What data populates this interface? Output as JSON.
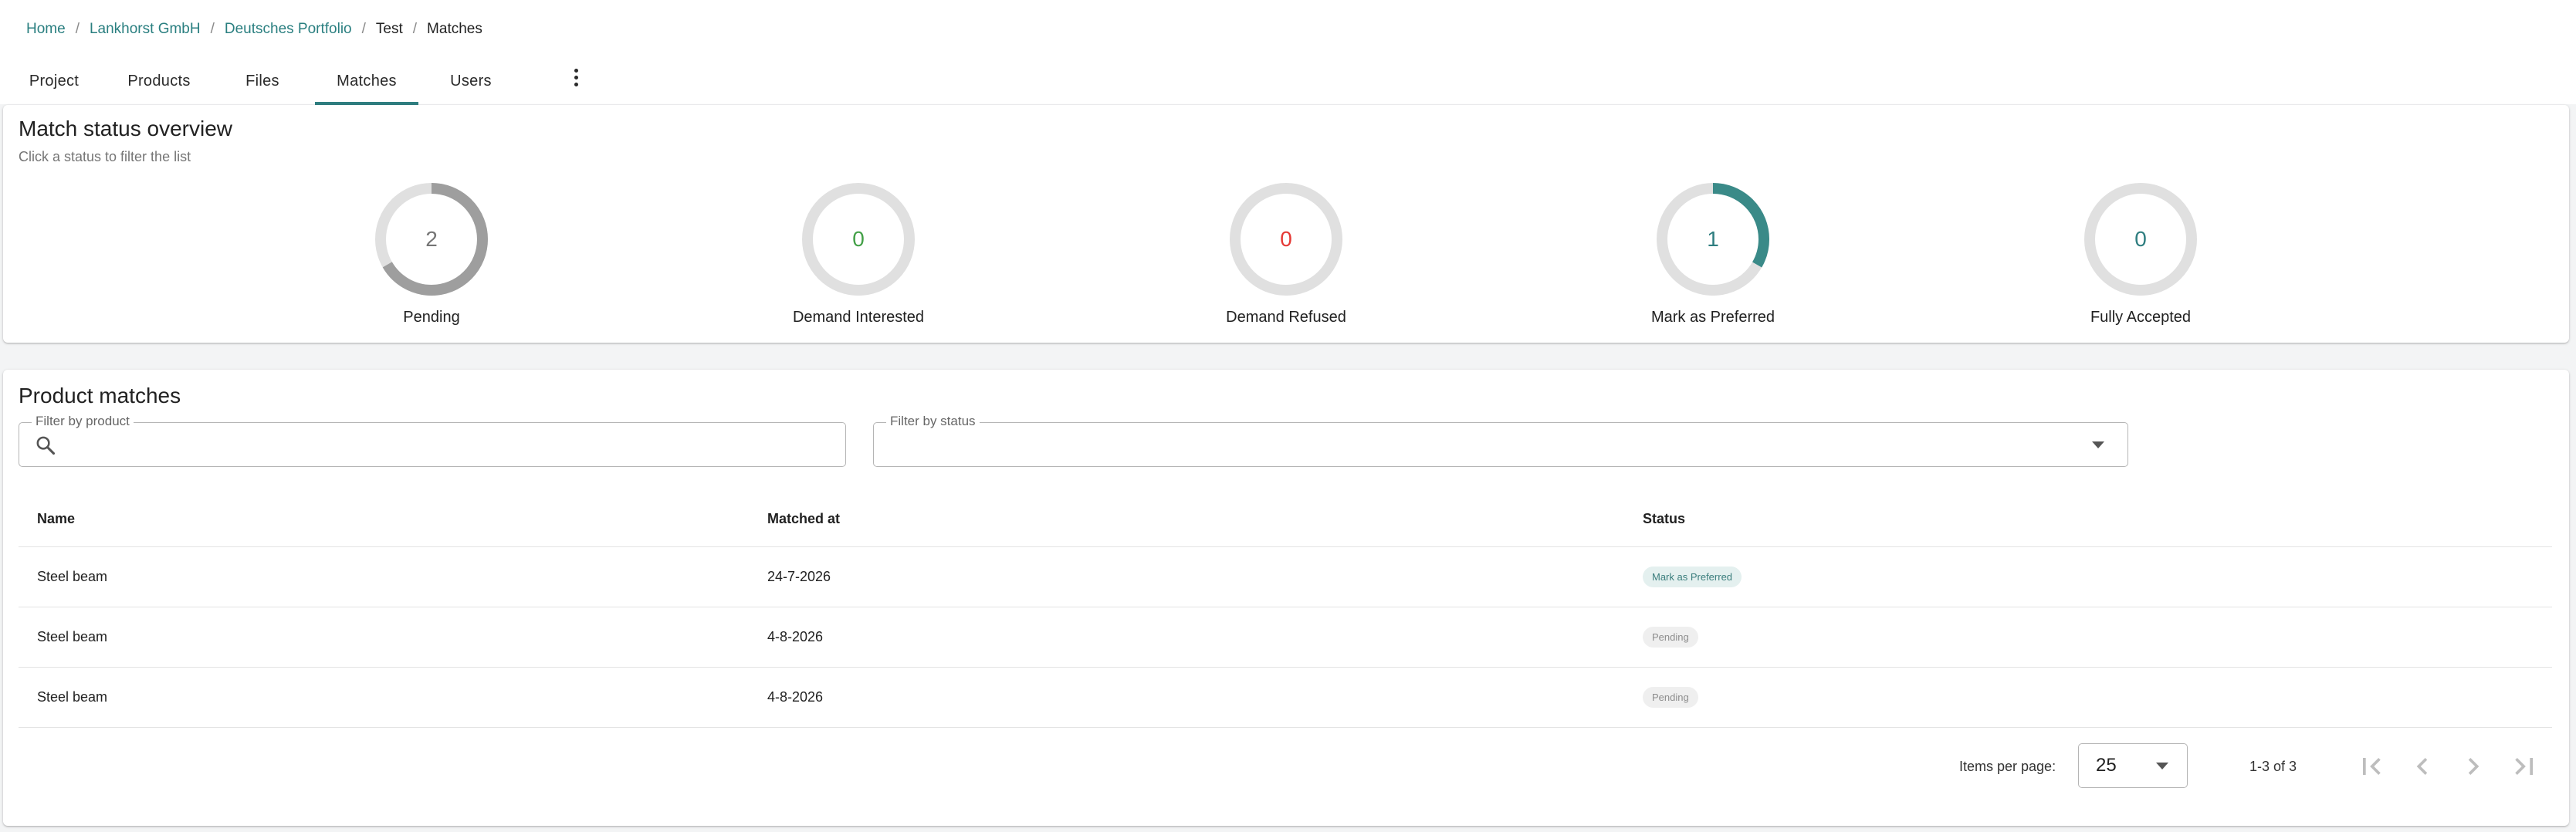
{
  "breadcrumb": {
    "items": [
      "Home",
      "Lankhorst GmbH",
      "Deutsches Portfolio",
      "Test"
    ],
    "current": "Matches",
    "separator": "/"
  },
  "tabs": [
    {
      "label": "Project"
    },
    {
      "label": "Products"
    },
    {
      "label": "Files"
    },
    {
      "label": "Matches",
      "active": true
    },
    {
      "label": "Users"
    }
  ],
  "more_menu_icon": "more-vertical-icon",
  "overview": {
    "title": "Match status overview",
    "subtitle": "Click a status to filter the list",
    "statuses": [
      {
        "label": "Pending",
        "count": "2",
        "fraction": 0.6667,
        "color": "#9e9e9e",
        "text_color": "#757575"
      },
      {
        "label": "Demand Interested",
        "count": "0",
        "fraction": 0,
        "color": "#4caf50",
        "text_color": "#43a047"
      },
      {
        "label": "Demand Refused",
        "count": "0",
        "fraction": 0,
        "color": "#e53935",
        "text_color": "#e53935"
      },
      {
        "label": "Mark as Preferred",
        "count": "1",
        "fraction": 0.3333,
        "color": "#3a8a88",
        "text_color": "#2f7e80"
      },
      {
        "label": "Fully Accepted",
        "count": "0",
        "fraction": 0,
        "color": "#2f7e80",
        "text_color": "#2f7e80"
      }
    ],
    "track_color": "#e0e0e0"
  },
  "matches": {
    "title": "Product matches",
    "filter_product": {
      "label": "Filter by product",
      "value": "",
      "icon": "search-icon"
    },
    "filter_status": {
      "label": "Filter by status",
      "value": "",
      "icon": "chevron-down-icon"
    },
    "columns": [
      "Name",
      "Matched at",
      "Status"
    ],
    "rows": [
      {
        "name": "Steel beam",
        "matched_at": "24-7-2026",
        "status": "Mark as Preferred",
        "chip_bg": "#e4f0ef",
        "chip_fg": "#3a7d7c"
      },
      {
        "name": "Steel beam",
        "matched_at": "4-8-2026",
        "status": "Pending",
        "chip_bg": "#efefef",
        "chip_fg": "#8d8d8d"
      },
      {
        "name": "Steel beam",
        "matched_at": "4-8-2026",
        "status": "Pending",
        "chip_bg": "#efefef",
        "chip_fg": "#8d8d8d"
      }
    ]
  },
  "paginator": {
    "items_per_page_label": "Items per page:",
    "page_size": "25",
    "range": "1-3 of 3",
    "buttons": [
      "first-page-icon",
      "previous-page-icon",
      "next-page-icon",
      "last-page-icon"
    ]
  }
}
